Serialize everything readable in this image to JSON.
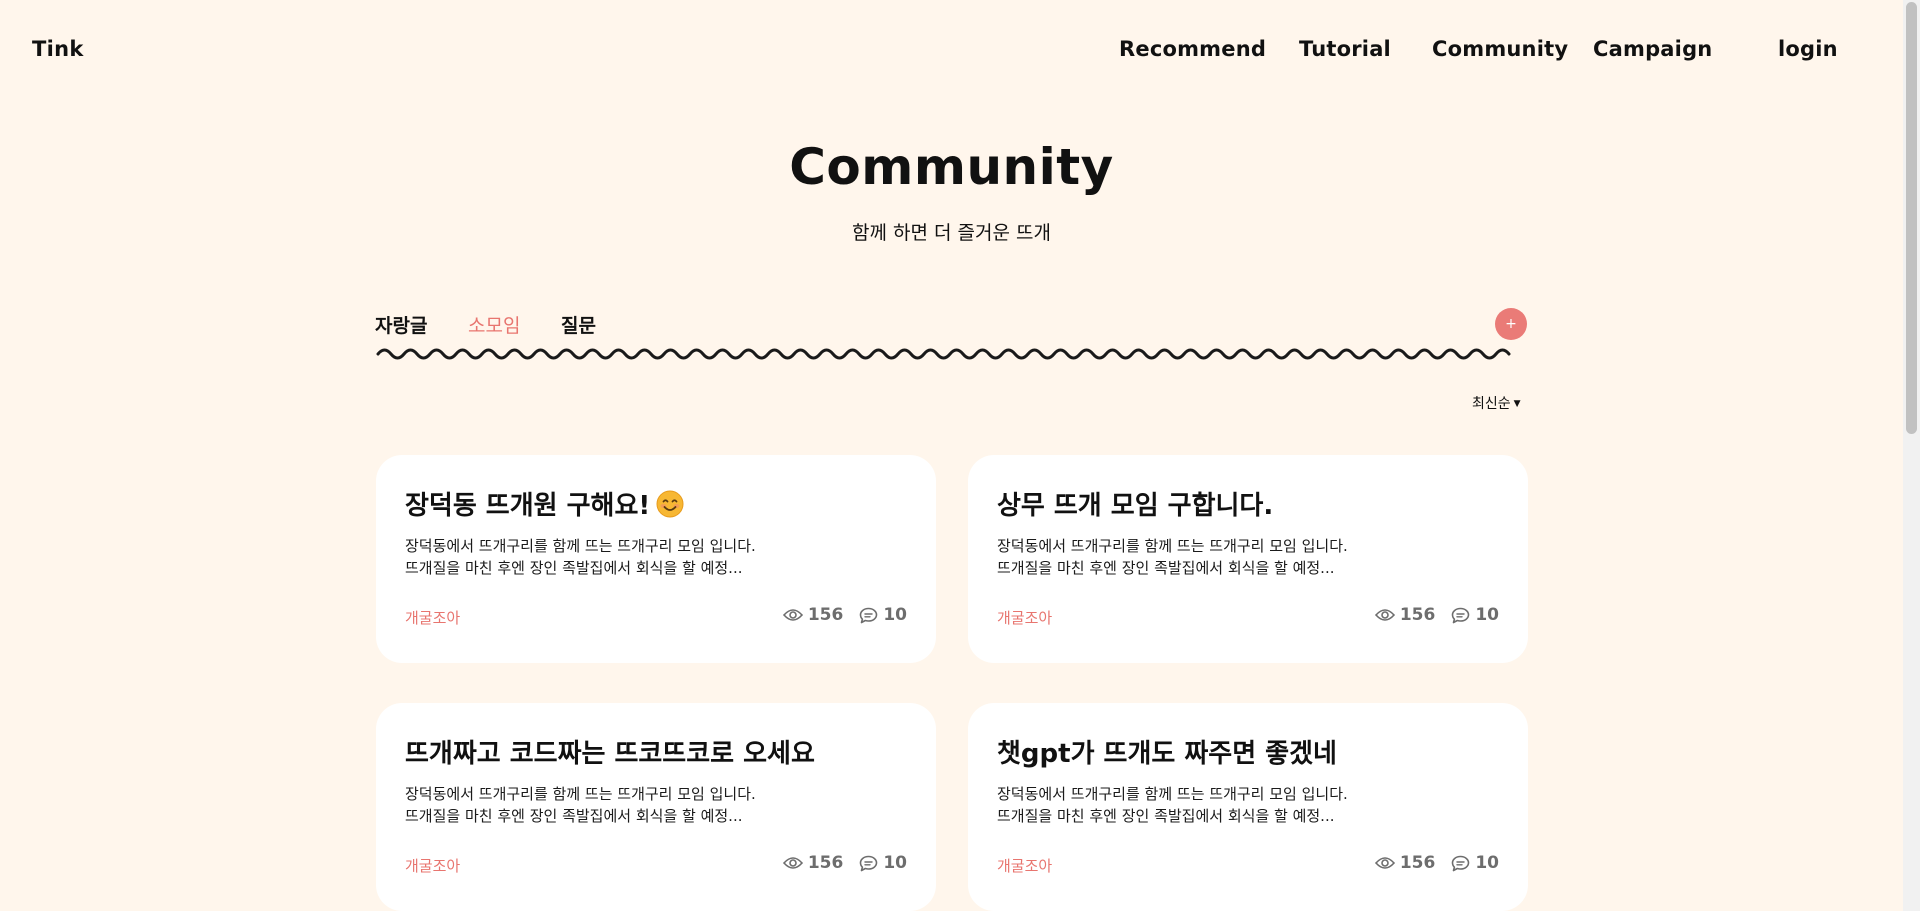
{
  "header": {
    "logo": "Tink",
    "nav": [
      "Recommend",
      "Tutorial",
      "Community",
      "Campaign",
      "login"
    ]
  },
  "hero": {
    "title": "Community",
    "subtitle": "함께 하면 더 즐거운 뜨개"
  },
  "tabs": {
    "items": [
      "자랑글",
      "소모임",
      "질문"
    ],
    "active_index": 1,
    "add_label": "+"
  },
  "sort": {
    "selected": "최신순"
  },
  "colors": {
    "accent": "#e8756f",
    "background": "#fff6ec",
    "card": "#ffffff"
  },
  "posts": [
    {
      "title": "장덕동 뜨개원 구해요!",
      "emoji": "smiling-face-icon",
      "body_line1": "장덕동에서 뜨개구리를 함께 뜨는 뜨개구리 모임 입니다.",
      "body_line2": "뜨개질을 마친 후엔 장인 족발집에서 회식을 할 예정...",
      "author": "개굴조아",
      "views": "156",
      "comments": "10"
    },
    {
      "title": "상무 뜨개 모임 구합니다.",
      "body_line1": "장덕동에서 뜨개구리를 함께 뜨는 뜨개구리 모임 입니다.",
      "body_line2": "뜨개질을 마친 후엔 장인 족발집에서 회식을 할 예정...",
      "author": "개굴조아",
      "views": "156",
      "comments": "10"
    },
    {
      "title": "뜨개짜고 코드짜는 뜨코뜨코로 오세요",
      "body_line1": "장덕동에서 뜨개구리를 함께 뜨는 뜨개구리 모임 입니다.",
      "body_line2": "뜨개질을 마친 후엔 장인 족발집에서 회식을 할 예정...",
      "author": "개굴조아",
      "views": "156",
      "comments": "10"
    },
    {
      "title": "챗gpt가 뜨개도 짜주면 좋겠네",
      "body_line1": "장덕동에서 뜨개구리를 함께 뜨는 뜨개구리 모임 입니다.",
      "body_line2": "뜨개질을 마친 후엔 장인 족발집에서 회식을 할 예정...",
      "author": "개굴조아",
      "views": "156",
      "comments": "10"
    }
  ]
}
